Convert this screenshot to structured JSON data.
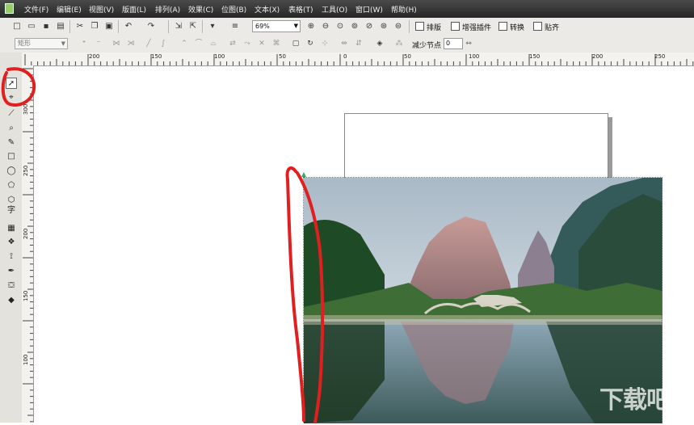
{
  "menubar": {
    "items": [
      "文件(F)",
      "编辑(E)",
      "视图(V)",
      "版面(L)",
      "排列(A)",
      "效果(C)",
      "位图(B)",
      "文本(X)",
      "表格(T)",
      "工具(O)",
      "窗口(W)",
      "帮助(H)"
    ]
  },
  "toolbar": {
    "zoom": "69%",
    "plugins": [
      "排版",
      "增强插件",
      "转换",
      "贴齐"
    ]
  },
  "propbar": {
    "shape_type": "矩形",
    "reduce_nodes_label": "减少节点",
    "reduce_nodes_value": "0"
  },
  "rulers": {
    "horizontal": [
      "200",
      "150",
      "100",
      "50",
      "0",
      "50",
      "100",
      "150",
      "200",
      "250"
    ],
    "vertical": [
      "300",
      "250",
      "200",
      "150",
      "100"
    ]
  },
  "toolbox": {
    "text_tool_glyph": "字"
  },
  "colors": {
    "annotation": "#e02020",
    "menubar": "#333333",
    "toolbar": "#eceae6"
  }
}
